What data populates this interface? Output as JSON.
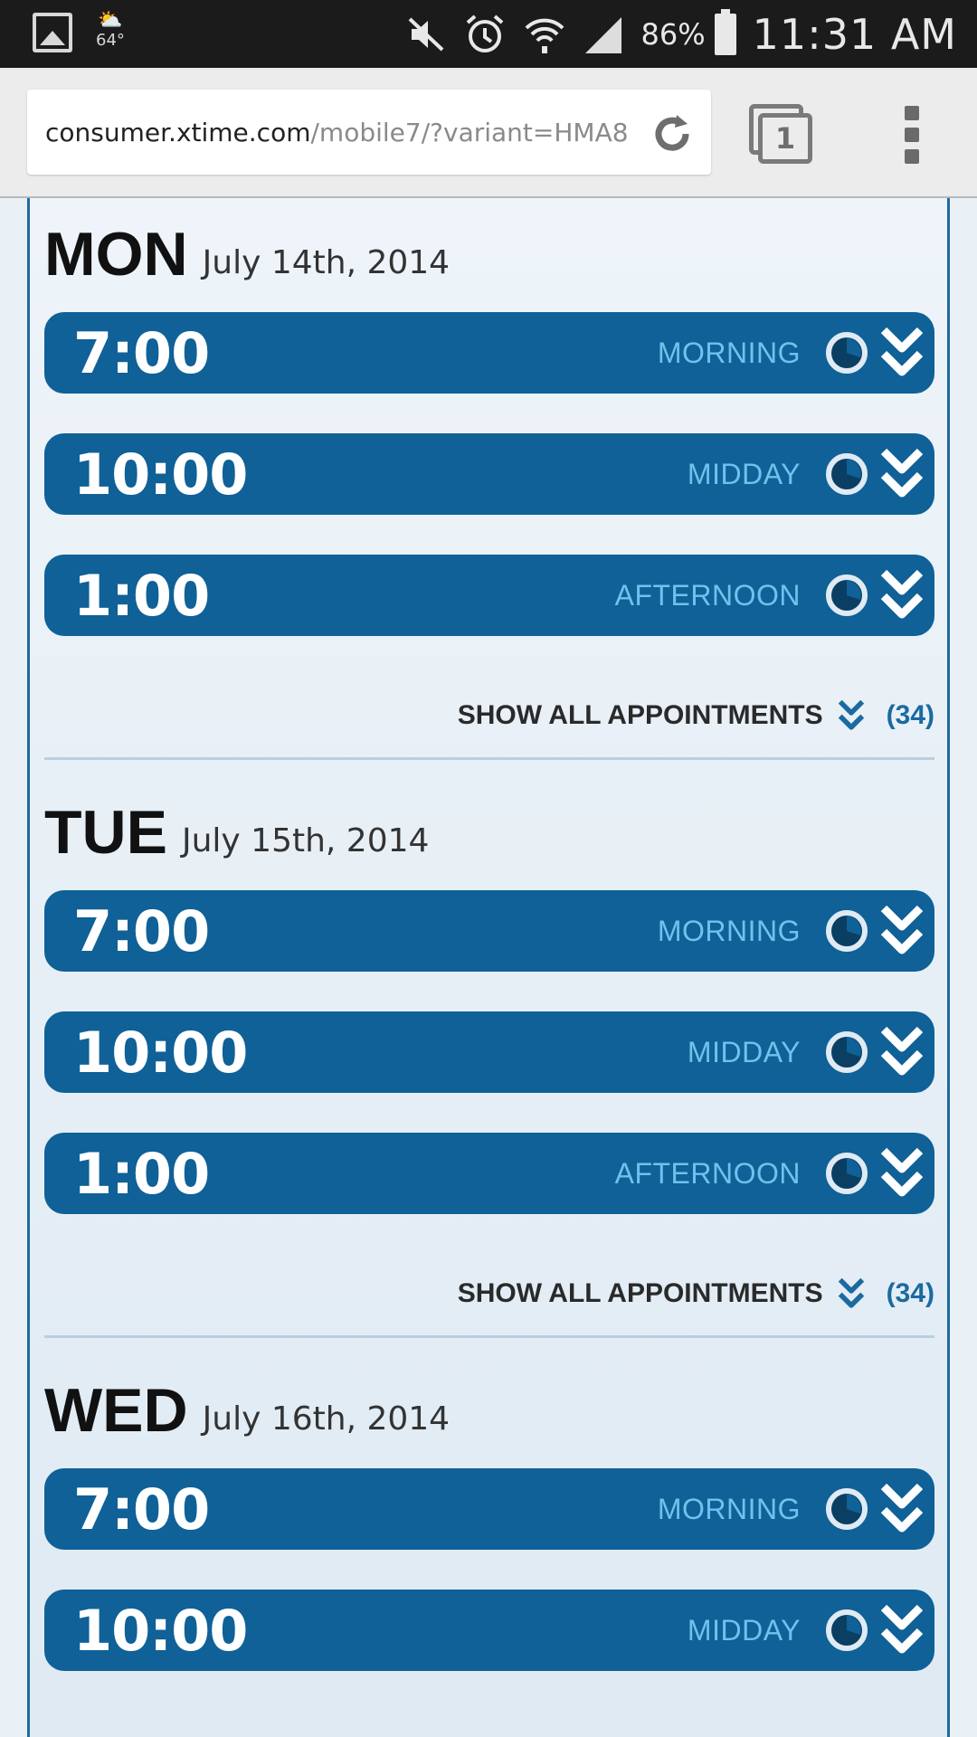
{
  "status_bar": {
    "weather_temp": "64°",
    "battery_percent": "86%",
    "time": "11:31 AM"
  },
  "browser": {
    "url_host": "consumer.xtime.com",
    "url_path": "/mobile7/?variant=HMA8",
    "tab_count": "1"
  },
  "days": [
    {
      "name": "MON",
      "date": "July 14th, 2014",
      "slots": [
        {
          "time": "7:00",
          "period": "MORNING"
        },
        {
          "time": "10:00",
          "period": "MIDDAY"
        },
        {
          "time": "1:00",
          "period": "AFTERNOON"
        }
      ],
      "show_all_label": "SHOW ALL APPOINTMENTS",
      "show_all_count": "(34)"
    },
    {
      "name": "TUE",
      "date": "July 15th, 2014",
      "slots": [
        {
          "time": "7:00",
          "period": "MORNING"
        },
        {
          "time": "10:00",
          "period": "MIDDAY"
        },
        {
          "time": "1:00",
          "period": "AFTERNOON"
        }
      ],
      "show_all_label": "SHOW ALL APPOINTMENTS",
      "show_all_count": "(34)"
    },
    {
      "name": "WED",
      "date": "July 16th, 2014",
      "slots": [
        {
          "time": "7:00",
          "period": "MORNING"
        },
        {
          "time": "10:00",
          "period": "MIDDAY"
        }
      ]
    }
  ],
  "colors": {
    "slot_bg": "#0f6197",
    "period_text": "#6ec2ec",
    "count_text": "#1b6aa0"
  }
}
